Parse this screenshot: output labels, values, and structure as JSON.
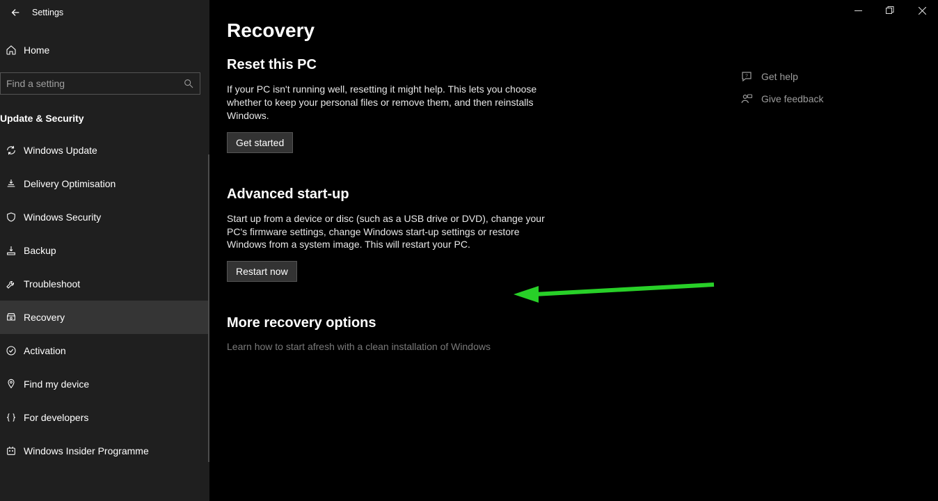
{
  "window": {
    "title": "Settings"
  },
  "sidebar": {
    "home": "Home",
    "search_placeholder": "Find a setting",
    "category": "Update & Security",
    "items": [
      {
        "label": "Windows Update",
        "icon": "sync-icon"
      },
      {
        "label": "Delivery Optimisation",
        "icon": "download-queue-icon"
      },
      {
        "label": "Windows Security",
        "icon": "shield-icon"
      },
      {
        "label": "Backup",
        "icon": "backup-icon"
      },
      {
        "label": "Troubleshoot",
        "icon": "wrench-icon"
      },
      {
        "label": "Recovery",
        "icon": "recovery-icon",
        "selected": true
      },
      {
        "label": "Activation",
        "icon": "check-circle-icon"
      },
      {
        "label": "Find my device",
        "icon": "location-pin-icon"
      },
      {
        "label": "For developers",
        "icon": "code-braces-icon"
      },
      {
        "label": "Windows Insider Programme",
        "icon": "windows-insider-icon"
      }
    ]
  },
  "main": {
    "page_title": "Recovery",
    "reset": {
      "heading": "Reset this PC",
      "body": "If your PC isn't running well, resetting it might help. This lets you choose whether to keep your personal files or remove them, and then reinstalls Windows.",
      "button": "Get started"
    },
    "advanced": {
      "heading": "Advanced start-up",
      "body": "Start up from a device or disc (such as a USB drive or DVD), change your PC's firmware settings, change Windows start-up settings or restore Windows from a system image. This will restart your PC.",
      "button": "Restart now"
    },
    "more": {
      "heading": "More recovery options",
      "link": "Learn how to start afresh with a clean installation of Windows"
    }
  },
  "aside": {
    "items": [
      {
        "label": "Get help",
        "icon": "help-bubble-icon"
      },
      {
        "label": "Give feedback",
        "icon": "feedback-person-icon"
      }
    ]
  }
}
